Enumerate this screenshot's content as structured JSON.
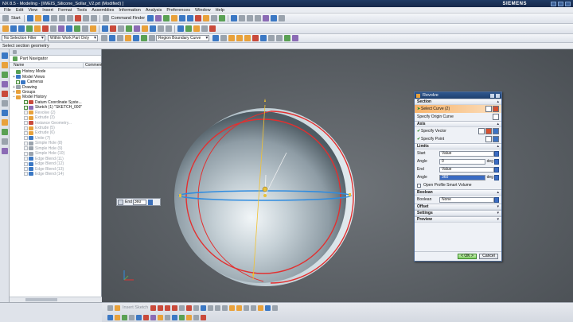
{
  "window": {
    "title": "NX 8.5 - Modeling - [IWEIS_Silicone_Sollar_V2.prt (Modified) ]",
    "brand": "SIEMENS"
  },
  "menu": {
    "items": [
      "File",
      "Edit",
      "View",
      "Insert",
      "Format",
      "Tools",
      "Assemblies",
      "Information",
      "Analysis",
      "Preferences",
      "Window",
      "Help"
    ]
  },
  "toolbar": {
    "start_label": "Start",
    "command_finder_label": "Command Finder",
    "selection_filter": "No Selection Filter",
    "selection_scope": "Within Work Part Only",
    "curve_rule": "Region Boundary Curve"
  },
  "cue_line": "Select section geometry",
  "navigator": {
    "title": "Part Navigator",
    "col_name": "Name",
    "col_comment": "Comment",
    "items": [
      {
        "label": "History Mode",
        "indent": 1,
        "dim": false,
        "exp": "",
        "check": false,
        "color": "#5aa154"
      },
      {
        "label": "Model Views",
        "indent": 1,
        "dim": false,
        "exp": "+",
        "check": false,
        "color": "#3b78c4"
      },
      {
        "label": "Cameras",
        "indent": 1,
        "dim": false,
        "exp": "",
        "check": true,
        "color": "#3b78c4"
      },
      {
        "label": "Drawing",
        "indent": 1,
        "dim": false,
        "exp": "+",
        "check": false,
        "color": "#9aa3ad"
      },
      {
        "label": "Groups",
        "indent": 1,
        "dim": false,
        "exp": "+",
        "check": false,
        "color": "#e8a13b"
      },
      {
        "label": "Model History",
        "indent": 1,
        "dim": false,
        "exp": "−",
        "check": false,
        "color": "#e8a13b"
      },
      {
        "label": "Datum Coordinate Syste...",
        "indent": 2,
        "dim": false,
        "exp": "",
        "check": true,
        "color": "#c94a3b"
      },
      {
        "label": "Sketch (1) \"SKETCH_000\"",
        "indent": 2,
        "dim": false,
        "exp": "",
        "check": true,
        "color": "#8b6bb5"
      },
      {
        "label": "Revolve (2)",
        "indent": 2,
        "dim": true,
        "exp": "",
        "check": true,
        "color": "#e8a13b"
      },
      {
        "label": "Extrude (3)",
        "indent": 2,
        "dim": true,
        "exp": "",
        "check": true,
        "color": "#e8a13b"
      },
      {
        "label": "Instance Geometry...",
        "indent": 2,
        "dim": true,
        "exp": "",
        "check": true,
        "color": "#c94a3b"
      },
      {
        "label": "Extrude (5)",
        "indent": 2,
        "dim": true,
        "exp": "",
        "check": true,
        "color": "#e8a13b"
      },
      {
        "label": "Extrude (6)",
        "indent": 2,
        "dim": true,
        "exp": "",
        "check": true,
        "color": "#e8a13b"
      },
      {
        "label": "Unite (7)",
        "indent": 2,
        "dim": true,
        "exp": "",
        "check": true,
        "color": "#3b78c4"
      },
      {
        "label": "Simple Hole (8)",
        "indent": 2,
        "dim": true,
        "exp": "",
        "check": true,
        "color": "#9aa3ad"
      },
      {
        "label": "Simple Hole (9)",
        "indent": 2,
        "dim": true,
        "exp": "",
        "check": true,
        "color": "#9aa3ad"
      },
      {
        "label": "Simple Hole (10)",
        "indent": 2,
        "dim": true,
        "exp": "",
        "check": true,
        "color": "#9aa3ad"
      },
      {
        "label": "Edge Blend (11)",
        "indent": 2,
        "dim": true,
        "exp": "",
        "check": true,
        "color": "#3b78c4"
      },
      {
        "label": "Edge Blend (12)",
        "indent": 2,
        "dim": true,
        "exp": "",
        "check": true,
        "color": "#3b78c4"
      },
      {
        "label": "Edge Blend (13)",
        "indent": 2,
        "dim": true,
        "exp": "",
        "check": true,
        "color": "#3b78c4"
      },
      {
        "label": "Edge Blend (14)",
        "indent": 2,
        "dim": true,
        "exp": "",
        "check": true,
        "color": "#3b78c4"
      }
    ]
  },
  "onscreen": {
    "label": "End",
    "value": "360"
  },
  "dialog": {
    "title": "Revolve",
    "section": {
      "header": "Section",
      "select_curve": "Select Curve (2)",
      "specify_origin": "Specify Origin Curve"
    },
    "axis": {
      "header": "Axis",
      "specify_vector": "Specify Vector",
      "specify_point": "Specify Point"
    },
    "limits": {
      "header": "Limits",
      "start_label": "Start",
      "start_type": "Value",
      "start_angle_label": "Angle",
      "start_angle": "0",
      "end_label": "End",
      "end_type": "Value",
      "end_angle_label": "Angle",
      "end_angle": "360",
      "unit": "deg",
      "open_profile": "Open Profile Smart Volume"
    },
    "boolean": {
      "header": "Boolean",
      "label": "Boolean",
      "value": "None"
    },
    "offset_header": "Offset",
    "settings_header": "Settings",
    "preview_header": "Preview",
    "ok_label": "< OK >",
    "cancel_label": "Cancel"
  },
  "bottom_toolbar": {
    "insert_sketch_label": "Insert Sketch"
  }
}
